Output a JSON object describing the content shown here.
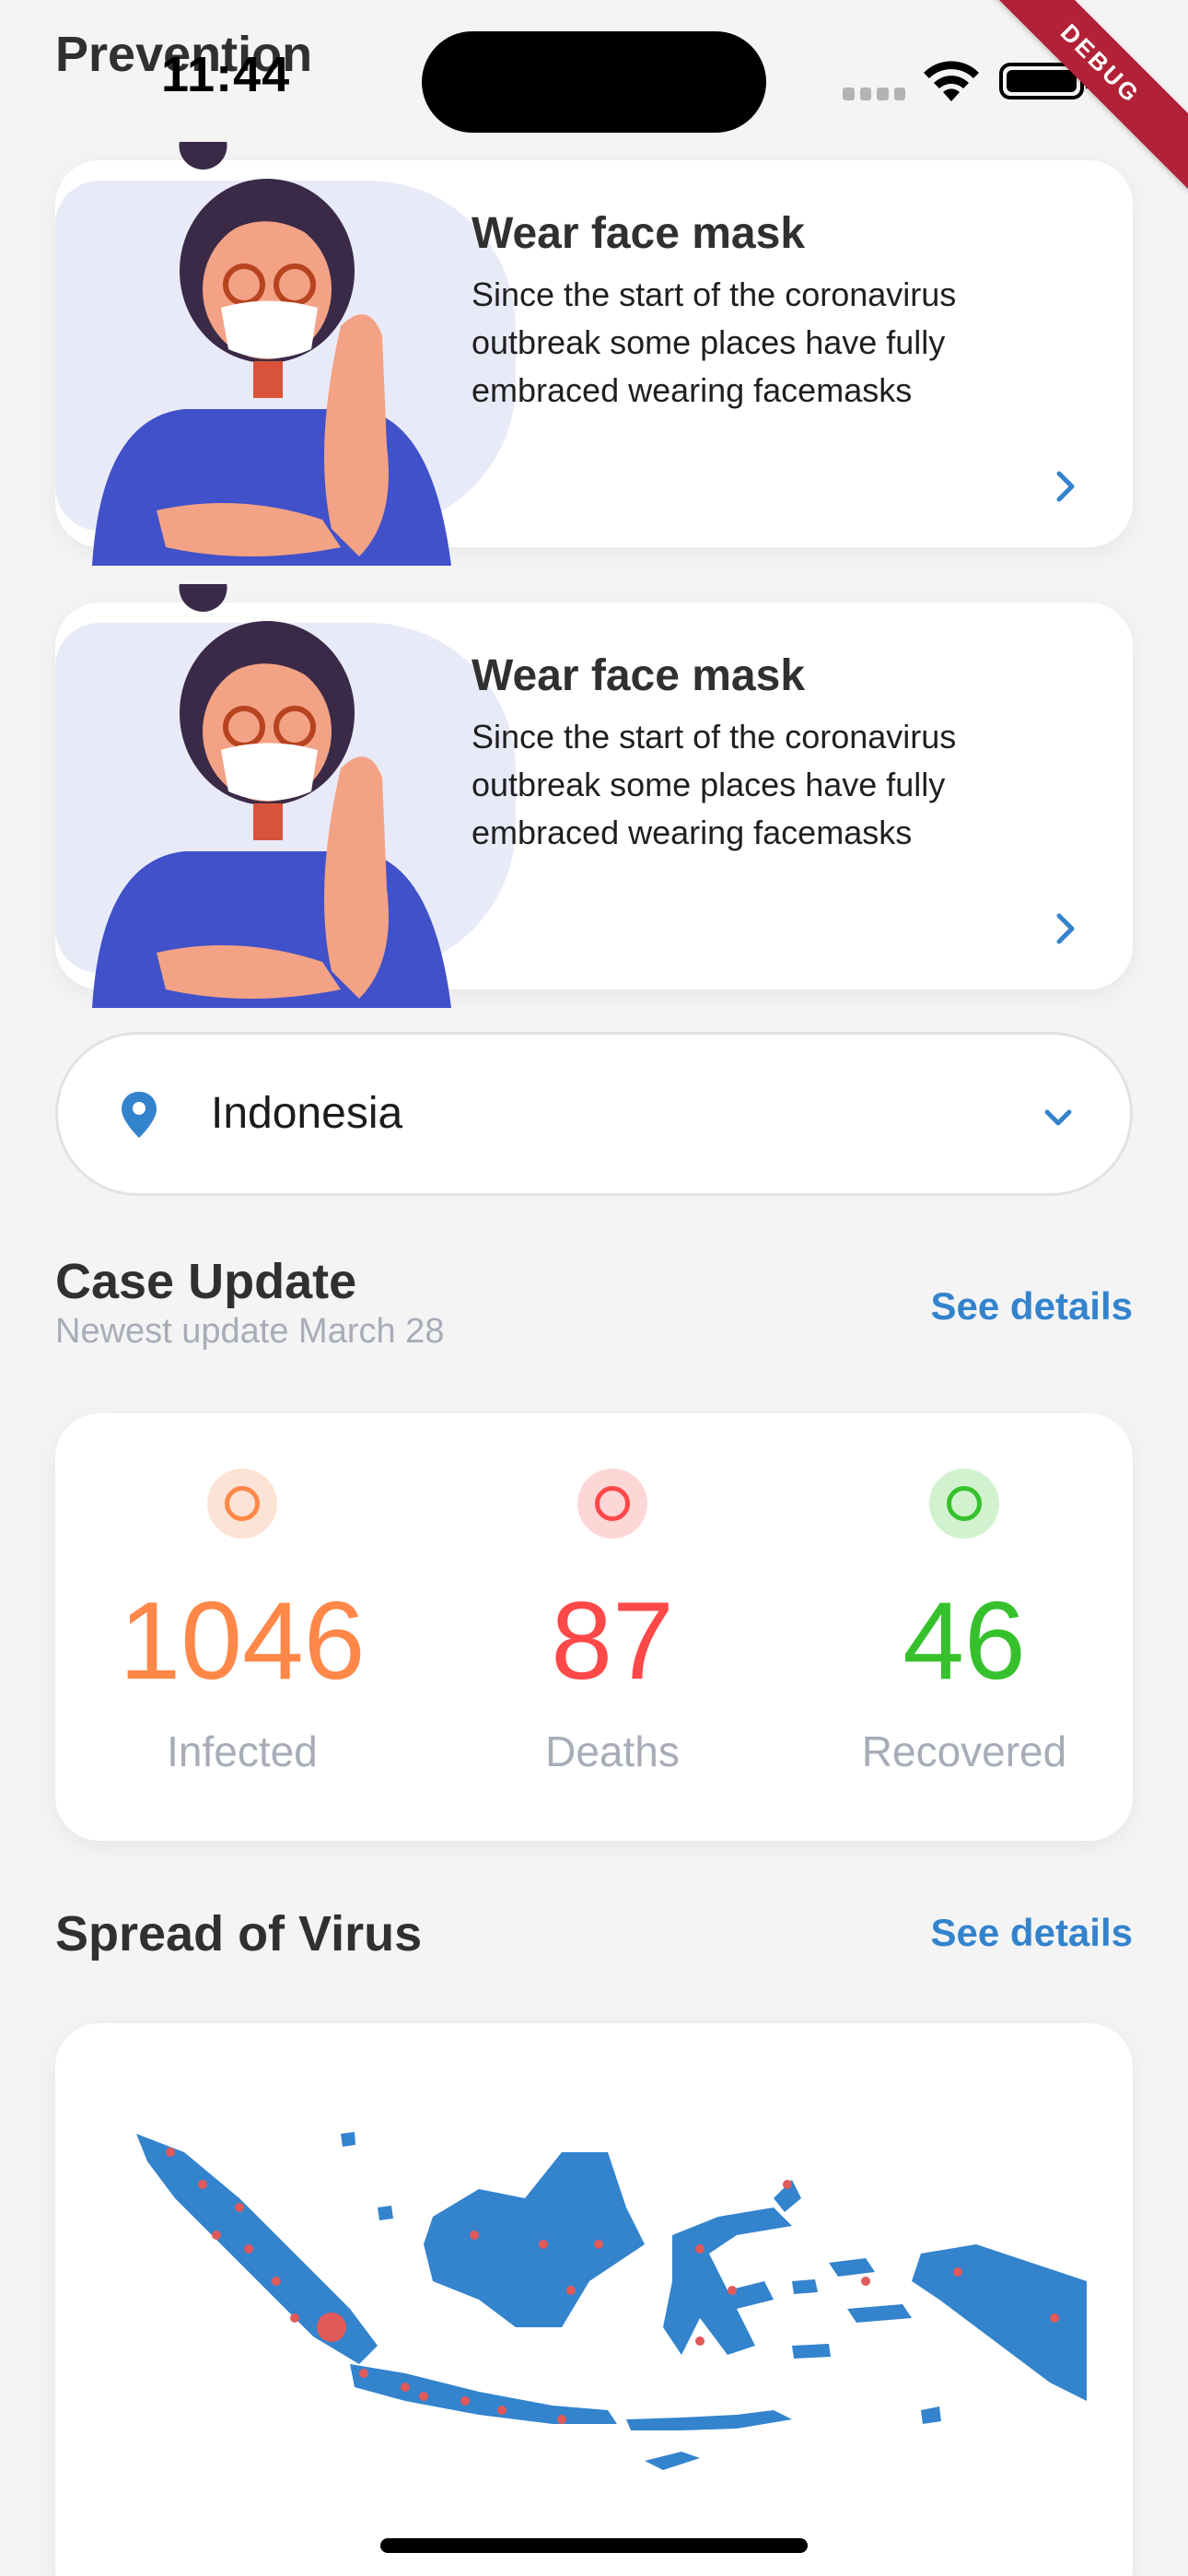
{
  "status": {
    "time": "11:44"
  },
  "header": {
    "title": "Prevention"
  },
  "debug": {
    "label": "DEBUG"
  },
  "prevention_cards": [
    {
      "title": "Wear face mask",
      "text": "Since the start of the coronavirus outbreak some places have fully embraced wearing facemasks"
    },
    {
      "title": "Wear face mask",
      "text": "Since the start of the coronavirus outbreak some places have fully embraced wearing facemasks"
    }
  ],
  "country": {
    "selected": "Indonesia"
  },
  "case_update": {
    "title": "Case Update",
    "subtitle": "Newest update March 28",
    "link": "See details",
    "stats": [
      {
        "value": "1046",
        "label": "Infected",
        "color": "#ff8748",
        "ring_bg": "#fde3d5"
      },
      {
        "value": "87",
        "label": "Deaths",
        "color": "#ff4848",
        "ring_bg": "#fdd6d6"
      },
      {
        "value": "46",
        "label": "Recovered",
        "color": "#36c12c",
        "ring_bg": "#d2f2cf"
      }
    ]
  },
  "spread": {
    "title": "Spread of Virus",
    "link": "See details"
  },
  "colors": {
    "accent": "#3383cd",
    "map": "#3383cd",
    "hotspot": "#e05a5a"
  }
}
